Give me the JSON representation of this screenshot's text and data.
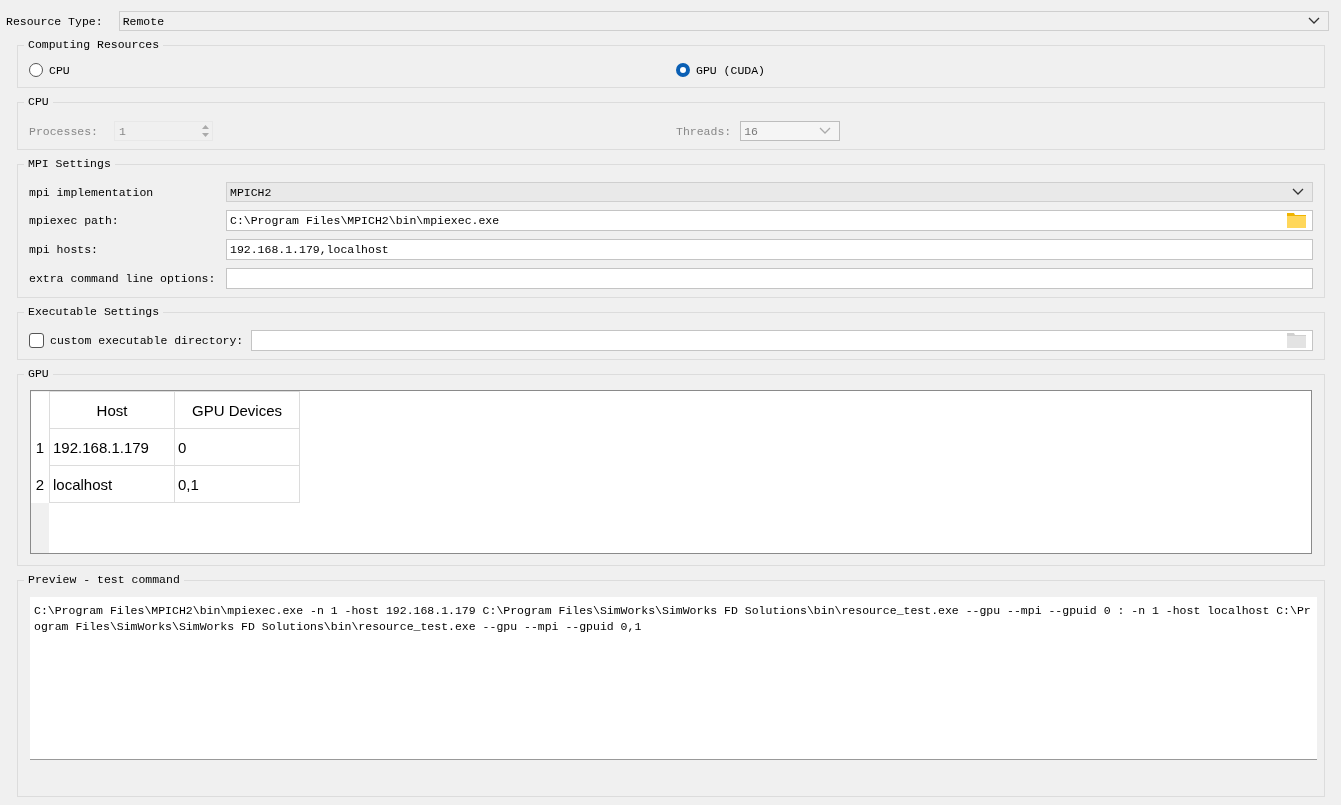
{
  "resource_type": {
    "label": "Resource Type:",
    "value": "Remote"
  },
  "computing_resources": {
    "title": "Computing Resources",
    "options": [
      {
        "label": "CPU",
        "selected": false
      },
      {
        "label": "GPU (CUDA)",
        "selected": true
      }
    ]
  },
  "cpu": {
    "title": "CPU",
    "disabled": true,
    "processes": {
      "label": "Processes:",
      "value": "1"
    },
    "threads": {
      "label": "Threads:",
      "value": "16"
    }
  },
  "mpi_settings": {
    "title": "MPI Settings",
    "fields": [
      {
        "kind": "dropdown",
        "label": "mpi implementation",
        "value": "MPICH2"
      },
      {
        "kind": "path",
        "label": "mpiexec path:",
        "value": "C:\\Program Files\\MPICH2\\bin\\mpiexec.exe"
      },
      {
        "kind": "text",
        "label": "mpi hosts:",
        "value": "192.168.1.179,localhost"
      },
      {
        "kind": "text",
        "label": "extra command line options:"
      }
    ]
  },
  "executable_settings": {
    "title": "Executable Settings",
    "custom_directory": {
      "label": "custom executable directory:",
      "checked": false
    }
  },
  "gpu": {
    "title": "GPU",
    "table": {
      "columns": [
        "Host",
        "GPU Devices"
      ],
      "rows": [
        {
          "index": "1",
          "cells": [
            "192.168.1.179",
            "0"
          ]
        },
        {
          "index": "2",
          "cells": [
            "localhost",
            "0,1"
          ]
        }
      ]
    }
  },
  "preview": {
    "title": "Preview - test command",
    "command": "C:\\Program Files\\MPICH2\\bin\\mpiexec.exe -n 1 -host 192.168.1.179 C:\\Program Files\\SimWorks\\SimWorks FD Solutions\\bin\\resource_test.exe --gpu --mpi --gpuid 0 : -n 1 -host localhost C:\\Program Files\\SimWorks\\SimWorks FD Solutions\\bin\\resource_test.exe --gpu --mpi --gpuid 0,1"
  }
}
